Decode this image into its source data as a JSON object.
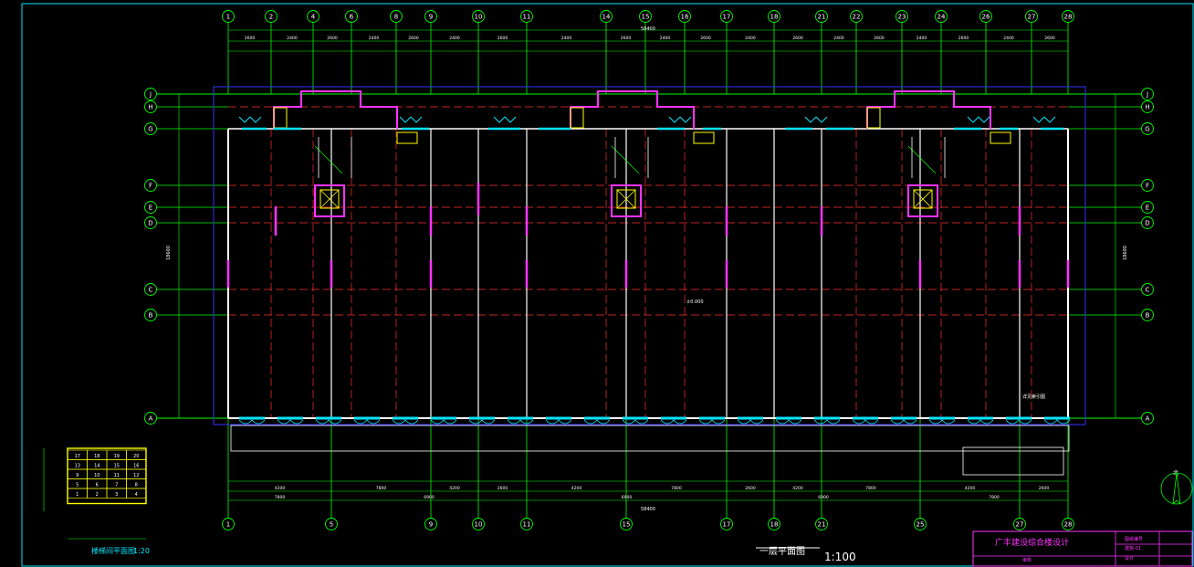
{
  "drawing": {
    "title": "一层平面图",
    "scale": "1:100",
    "background": "#000000",
    "colors": {
      "axis_line": "#00ff00",
      "grid_line": "#ff3030",
      "wall": "#ffffff",
      "wall_finish": "#ff33ff",
      "window": "#00e5ff",
      "outline": "#3333ff",
      "frame": "#00e5ff",
      "accent": "#ffff00",
      "title_block": "#ff33ff"
    }
  },
  "axes": {
    "top": [
      "1",
      "2",
      "4",
      "6",
      "8",
      "9",
      "10",
      "11",
      "14",
      "15",
      "16",
      "17",
      "18",
      "21",
      "22",
      "23",
      "24",
      "26",
      "27",
      "28"
    ],
    "bottom": [
      "1",
      "5",
      "9",
      "10",
      "11",
      "15",
      "17",
      "18",
      "21",
      "25",
      "27",
      "28"
    ],
    "rows": [
      "J",
      "H",
      "G",
      "F",
      "E",
      "D",
      "C",
      "B",
      "A"
    ]
  },
  "dimensions": {
    "total_length": "58400",
    "overall_depth": "18600",
    "top_segments": [
      "2600",
      "2400",
      "2600",
      "2400",
      "2600",
      "2400",
      "2600",
      "2400",
      "2600",
      "2400",
      "2600",
      "2400",
      "2600",
      "2400",
      "2600",
      "2400",
      "2600",
      "2400",
      "2600"
    ],
    "bottom_segments": [
      "4200",
      "7800",
      "4200",
      "2600",
      "4200",
      "7800",
      "2600",
      "4200",
      "7800",
      "4200",
      "2600"
    ],
    "bottom_totals": [
      "7800",
      "6900",
      "6900",
      "6900",
      "7800"
    ]
  },
  "detail": {
    "title": "楼梯间平面图",
    "scale": "1:20",
    "cells": [
      [
        "17",
        "18",
        "19",
        "20"
      ],
      [
        "13",
        "14",
        "15",
        "16"
      ],
      [
        "9",
        "10",
        "11",
        "12"
      ],
      [
        "5",
        "6",
        "7",
        "8"
      ],
      [
        "1",
        "2",
        "3",
        "4"
      ]
    ]
  },
  "title_block": {
    "project": "广丰建设综合楼设计",
    "drawing_no": "图纸编号",
    "sheet": "建施-01",
    "designer": "设计",
    "checker": "审核"
  },
  "notes": {
    "elevation": "±0.000",
    "callout": "详见索引图"
  },
  "north_arrow": "北"
}
